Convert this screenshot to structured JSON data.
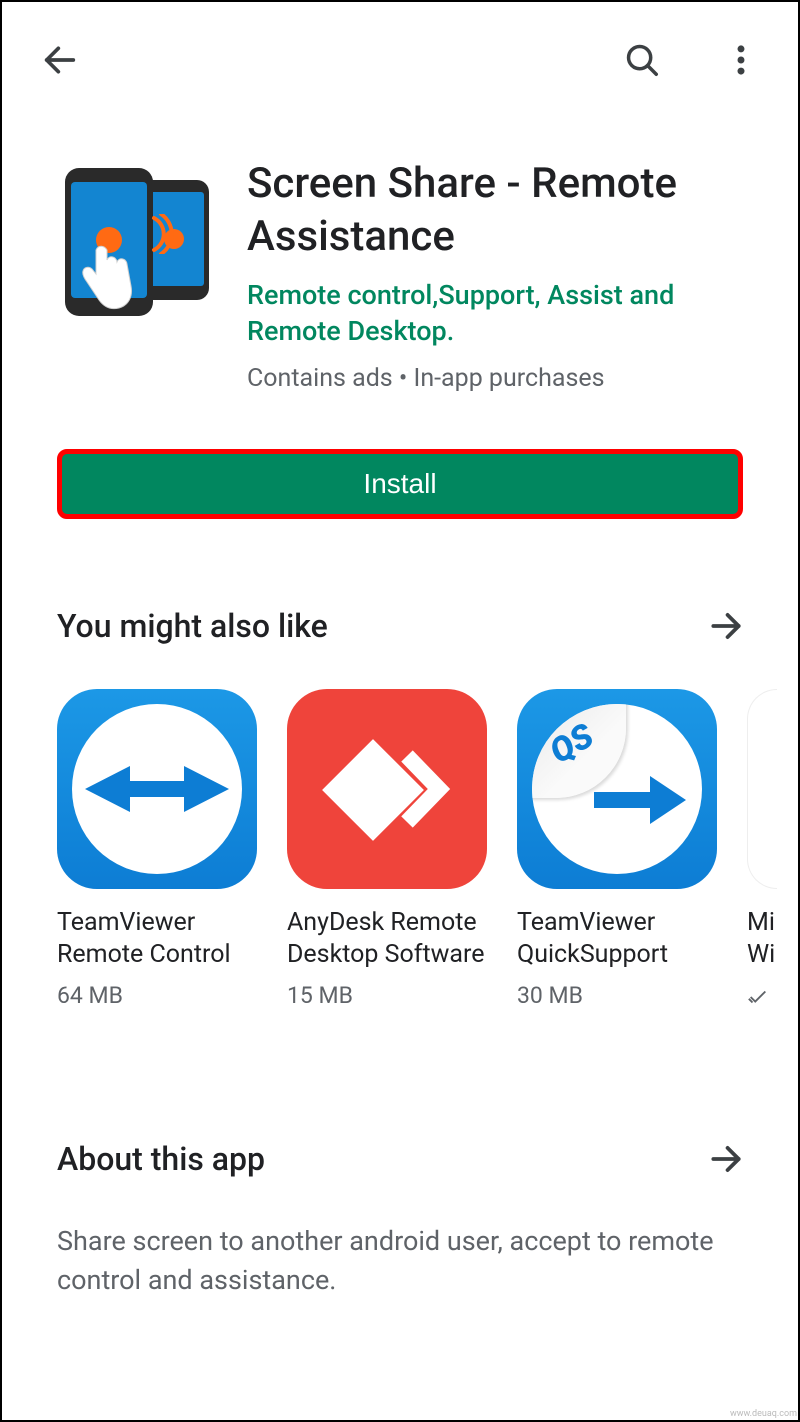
{
  "app": {
    "title": "Screen Share - Remote Assistance",
    "developer": "Remote control,Support, Assist and Remote Desktop.",
    "meta": "Contains ads  •  In-app purchases",
    "install_label": "Install"
  },
  "suggestions": {
    "heading": "You might also like",
    "items": [
      {
        "name": "TeamViewer Remote Control",
        "size": "64 MB"
      },
      {
        "name": "AnyDesk Remote Desktop Software",
        "size": "15 MB"
      },
      {
        "name": "TeamViewer QuickSupport",
        "size": "30 MB"
      },
      {
        "name_partial_line1": "Mi",
        "name_partial_line2": "Wi"
      }
    ]
  },
  "about": {
    "heading": "About this app",
    "description": "Share screen to another android user, accept to remote control and assistance."
  }
}
